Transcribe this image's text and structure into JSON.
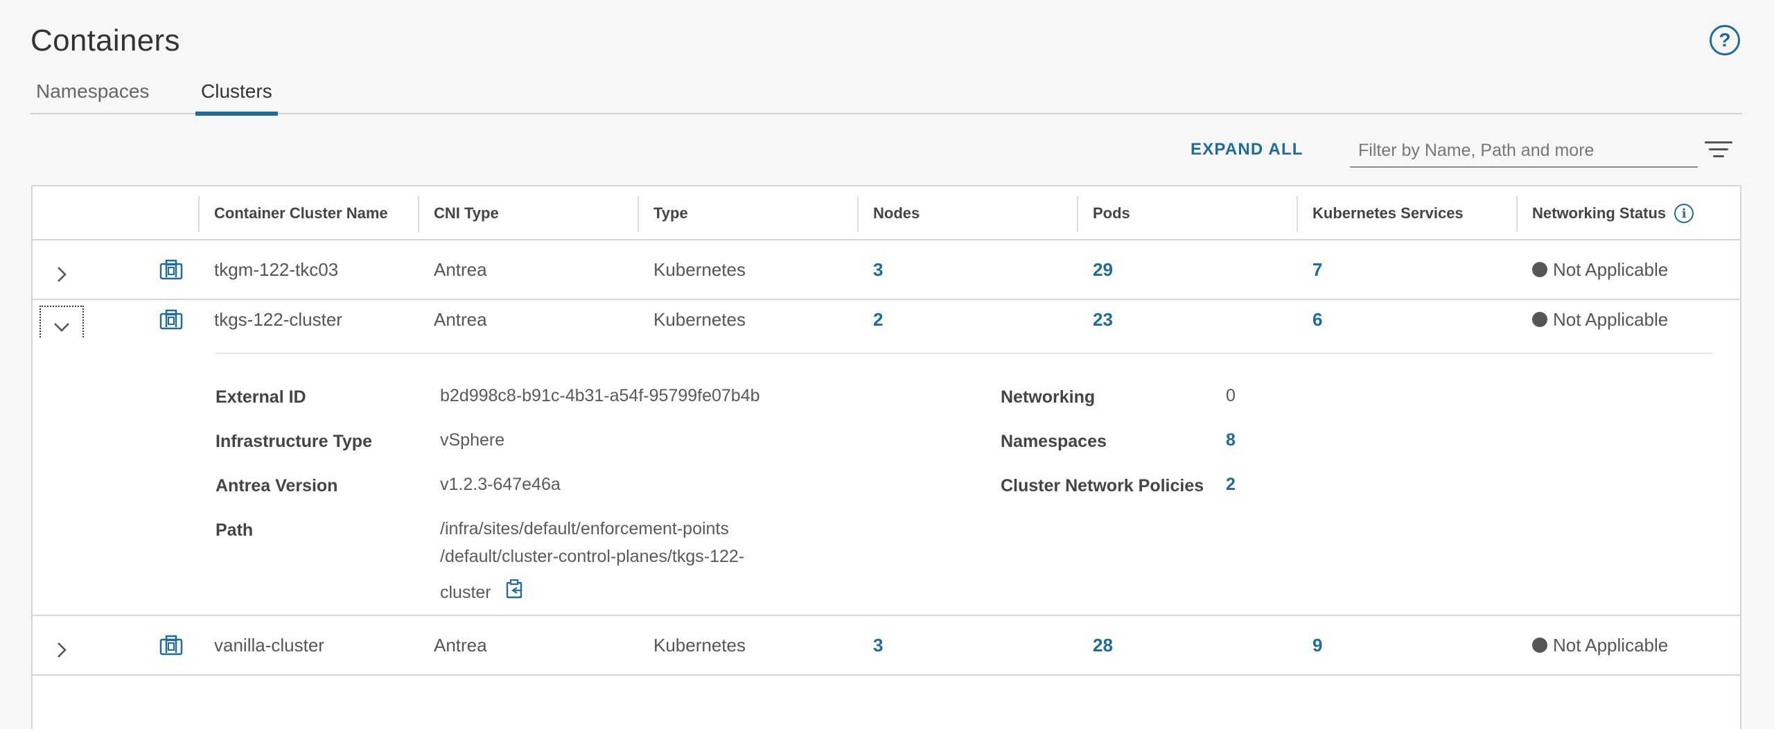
{
  "page": {
    "title": "Containers"
  },
  "tabs": [
    {
      "label": "Namespaces",
      "active": false
    },
    {
      "label": "Clusters",
      "active": true
    }
  ],
  "toolbar": {
    "expand_all": "EXPAND ALL",
    "filter_placeholder": "Filter by Name, Path and more",
    "filter_value": ""
  },
  "columns": {
    "name": "Container Cluster Name",
    "cni": "CNI Type",
    "type": "Type",
    "nodes": "Nodes",
    "pods": "Pods",
    "services": "Kubernetes Services",
    "status": "Networking Status"
  },
  "rows": [
    {
      "name": "tkgm-122-tkc03",
      "cni": "Antrea",
      "type": "Kubernetes",
      "nodes": "3",
      "pods": "29",
      "services": "7",
      "status": "Not Applicable",
      "expanded": false
    },
    {
      "name": "tkgs-122-cluster",
      "cni": "Antrea",
      "type": "Kubernetes",
      "nodes": "2",
      "pods": "23",
      "services": "6",
      "status": "Not Applicable",
      "expanded": true
    },
    {
      "name": "vanilla-cluster",
      "cni": "Antrea",
      "type": "Kubernetes",
      "nodes": "3",
      "pods": "28",
      "services": "9",
      "status": "Not Applicable",
      "expanded": false
    }
  ],
  "detail": {
    "external_id_label": "External ID",
    "external_id": "b2d998c8-b91c-4b31-a54f-95799fe07b4b",
    "infra_type_label": "Infrastructure Type",
    "infra_type": "vSphere",
    "antrea_version_label": "Antrea Version",
    "antrea_version": "v1.2.3-647e46a",
    "path_label": "Path",
    "path_line1": "/infra/sites/default/enforcement-points",
    "path_line2": "/default/cluster-control-planes/tkgs-122-",
    "path_line3": "cluster",
    "networking_label": "Networking",
    "networking": "0",
    "namespaces_label": "Namespaces",
    "namespaces": "8",
    "cnp_label": "Cluster Network Policies",
    "cnp": "2"
  },
  "colors": {
    "accent": "#1f6b9a",
    "status_dot": "#565656"
  }
}
